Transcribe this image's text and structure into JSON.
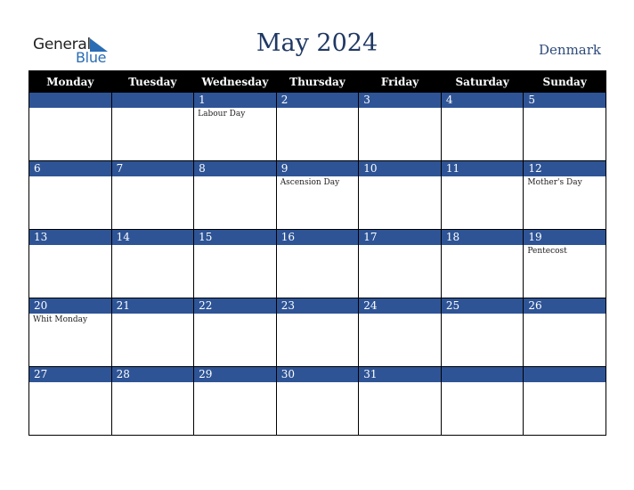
{
  "header": {
    "logo": {
      "line1": "General",
      "line2": "Blue"
    },
    "title": "May 2024",
    "country": "Denmark"
  },
  "colors": {
    "header_bg": "#000000",
    "day_bar": "#2e5496",
    "title": "#1f3864",
    "logo_blue": "#2a6db4"
  },
  "weekdays": [
    "Monday",
    "Tuesday",
    "Wednesday",
    "Thursday",
    "Friday",
    "Saturday",
    "Sunday"
  ],
  "weeks": [
    [
      {
        "day": "",
        "holiday": ""
      },
      {
        "day": "",
        "holiday": ""
      },
      {
        "day": "1",
        "holiday": "Labour Day"
      },
      {
        "day": "2",
        "holiday": ""
      },
      {
        "day": "3",
        "holiday": ""
      },
      {
        "day": "4",
        "holiday": ""
      },
      {
        "day": "5",
        "holiday": ""
      }
    ],
    [
      {
        "day": "6",
        "holiday": ""
      },
      {
        "day": "7",
        "holiday": ""
      },
      {
        "day": "8",
        "holiday": ""
      },
      {
        "day": "9",
        "holiday": "Ascension Day"
      },
      {
        "day": "10",
        "holiday": ""
      },
      {
        "day": "11",
        "holiday": ""
      },
      {
        "day": "12",
        "holiday": "Mother's Day"
      }
    ],
    [
      {
        "day": "13",
        "holiday": ""
      },
      {
        "day": "14",
        "holiday": ""
      },
      {
        "day": "15",
        "holiday": ""
      },
      {
        "day": "16",
        "holiday": ""
      },
      {
        "day": "17",
        "holiday": ""
      },
      {
        "day": "18",
        "holiday": ""
      },
      {
        "day": "19",
        "holiday": "Pentecost"
      }
    ],
    [
      {
        "day": "20",
        "holiday": "Whit Monday"
      },
      {
        "day": "21",
        "holiday": ""
      },
      {
        "day": "22",
        "holiday": ""
      },
      {
        "day": "23",
        "holiday": ""
      },
      {
        "day": "24",
        "holiday": ""
      },
      {
        "day": "25",
        "holiday": ""
      },
      {
        "day": "26",
        "holiday": ""
      }
    ],
    [
      {
        "day": "27",
        "holiday": ""
      },
      {
        "day": "28",
        "holiday": ""
      },
      {
        "day": "29",
        "holiday": ""
      },
      {
        "day": "30",
        "holiday": ""
      },
      {
        "day": "31",
        "holiday": ""
      },
      {
        "day": "",
        "holiday": ""
      },
      {
        "day": "",
        "holiday": ""
      }
    ]
  ]
}
